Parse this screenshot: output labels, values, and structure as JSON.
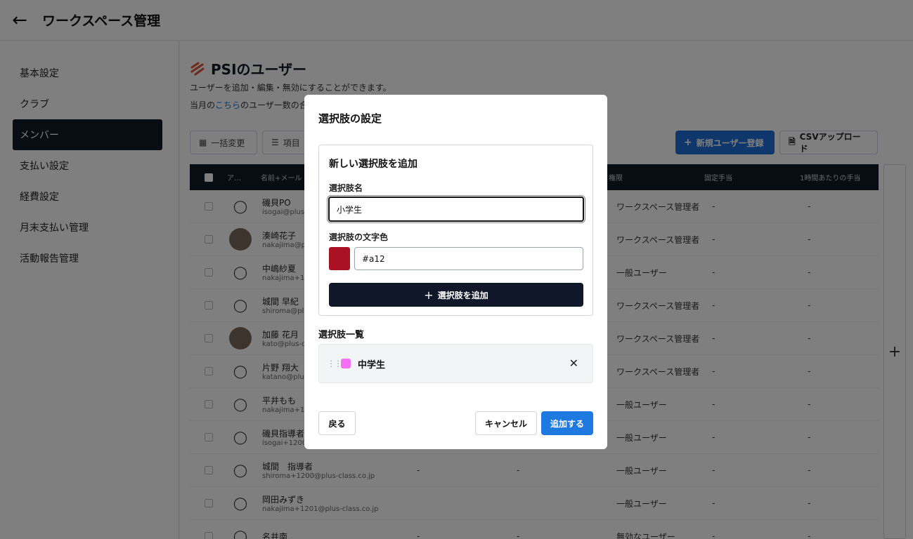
{
  "header": {
    "title": "ワークスペース管理"
  },
  "sidebar": {
    "items": [
      {
        "label": "基本設定"
      },
      {
        "label": "クラブ"
      },
      {
        "label": "メンバー"
      },
      {
        "label": "支払い設定"
      },
      {
        "label": "経費設定"
      },
      {
        "label": "月末支払い管理"
      },
      {
        "label": "活動報告管理"
      }
    ]
  },
  "main": {
    "title": "PSIのユーザー",
    "description": "ユーザーを追加・編集・無効にすることができます。",
    "desc2_prefix": "当月の",
    "desc2_link": "こちら",
    "desc2_suffix": "のユーザー数の合",
    "toolbar": {
      "bulk_label": "一括変更",
      "items_label": "項目",
      "new_user_label": "新規ユーザー登録",
      "csv_label": "CSVアップロード"
    },
    "columns": {
      "a": "ア…",
      "name": "名前+メール",
      "role": "権限",
      "fixed": "固定手当",
      "hourly": "1時間あたりの手当"
    },
    "rows": [
      {
        "name": "磯貝PO",
        "email": "isogai@plus-",
        "c3": "",
        "c4": "",
        "role": "ワークスペース管理者",
        "fixed": "-",
        "hourly": "-"
      },
      {
        "name": "湊崎花子",
        "email": "nakajima@p",
        "c3": "",
        "c4": "",
        "role": "ワークスペース管理者",
        "fixed": "-",
        "hourly": "-"
      },
      {
        "name": "中嶋紗夏",
        "email": "nakajima+11",
        "c3": "",
        "c4": "",
        "role": "一般ユーザー",
        "fixed": "-",
        "hourly": "-"
      },
      {
        "name": "城間 早紀",
        "email": "shiroma@pl",
        "c3": "",
        "c4": "",
        "role": "ワークスペース管理者",
        "fixed": "-",
        "hourly": "-"
      },
      {
        "name": "加藤 花月",
        "email": "kato@plus-c",
        "c3": "",
        "c4": "",
        "role": "ワークスペース管理者",
        "fixed": "-",
        "hourly": "-"
      },
      {
        "name": "片野 翔大",
        "email": "katano@plus",
        "c3": "",
        "c4": "",
        "role": "ワークスペース管理者",
        "fixed": "-",
        "hourly": "-"
      },
      {
        "name": "平井もも",
        "email": "nakajima+12",
        "c3": "",
        "c4": "",
        "role": "一般ユーザー",
        "fixed": "-",
        "hourly": "-"
      },
      {
        "name": "磯貝指導者",
        "email": "isogai+1200",
        "c3": "",
        "c4": "",
        "role": "一般ユーザー",
        "fixed": "-",
        "hourly": "-"
      },
      {
        "name": "城間　指導者",
        "email": "shiroma+1200@plus-class.co.jp",
        "c3": "-",
        "c4": "-",
        "role": "一般ユーザー",
        "fixed": "-",
        "hourly": "-"
      },
      {
        "name": "岡田みずき",
        "email": "nakajima+1201@plus-class.co.jp",
        "c3": "",
        "c4": "",
        "role": "一般ユーザー",
        "fixed": "-",
        "hourly": "-"
      },
      {
        "name": "名井南",
        "email": "",
        "c3": "-",
        "c4": "-",
        "role": "無効なユーザー",
        "fixed": "-",
        "hourly": "-"
      }
    ]
  },
  "modal": {
    "title": "選択肢の設定",
    "add_section_title": "新しい選択肢を追加",
    "name_label": "選択肢名",
    "name_value": "小学生",
    "color_label": "選択肢の文字色",
    "color_value": "#a12",
    "swatch_color": "#aa1122",
    "add_button_label": "選択肢を追加",
    "list_title": "選択肢一覧",
    "options": [
      {
        "label": "中学生",
        "color": "#f36ff3"
      }
    ],
    "back_label": "戻る",
    "cancel_label": "キャンセル",
    "submit_label": "追加する"
  }
}
